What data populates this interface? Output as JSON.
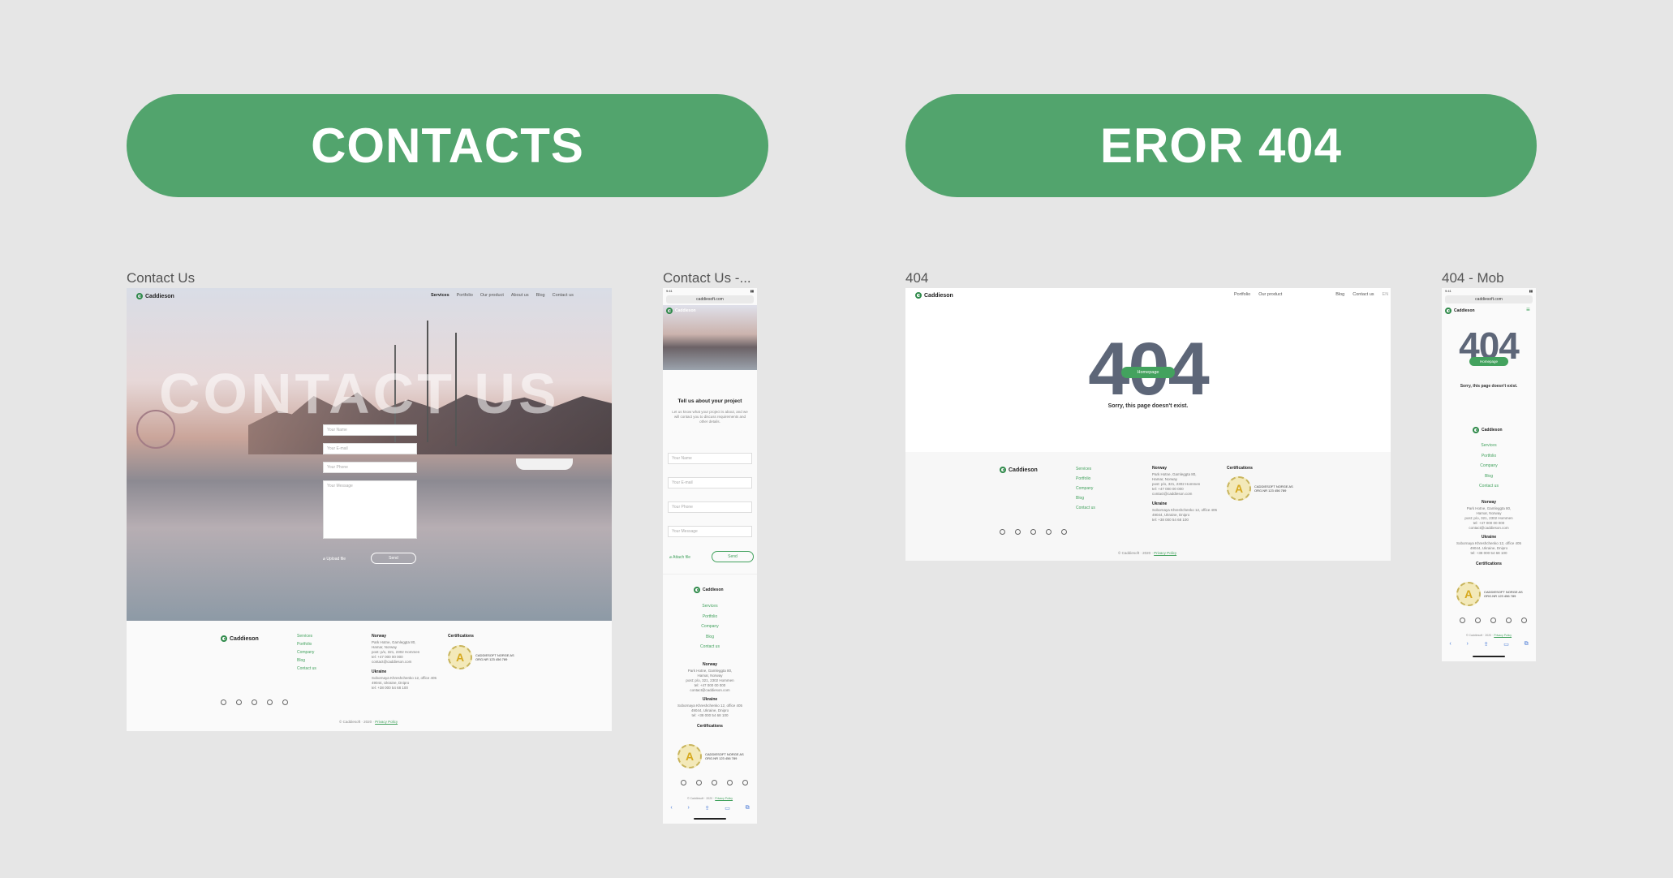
{
  "sections": {
    "contacts": "CONTACTS",
    "error": "EROR 404"
  },
  "boards": {
    "contact_desktop": "Contact Us",
    "contact_mobile": "Contact Us -...",
    "error_desktop": "404",
    "error_mobile": "404 - Mob"
  },
  "brand": {
    "name": "Caddieson",
    "accent": "#52a46d",
    "link_green": "#43a25e"
  },
  "nav": {
    "items": [
      "Services",
      "Portfolio",
      "Our product",
      "About us",
      "Blog",
      "Contact us"
    ],
    "error_items": [
      "Portfolio",
      "Our product",
      "Blog",
      "Contact us"
    ],
    "lang": "EN"
  },
  "contact_page": {
    "hero_title": "CONTACT US",
    "placeholders": {
      "name": "Your Name",
      "email": "Your E-mail",
      "phone": "Your Phone",
      "message": "Your Message"
    },
    "attach": "Upload file",
    "attach_mobile": "Attach file",
    "send": "Send",
    "mobile_heading": "Tell us about your project",
    "mobile_intro": "Let us know what your project is about, and we will contact you to discuss requirements and other details."
  },
  "footer": {
    "links": [
      "Services",
      "Portfolio",
      "Company",
      "Blog",
      "Contact us"
    ],
    "norway_title": "Norway",
    "norway_lines": [
      "Park Hotne, Gamleggta 80,",
      "Hamar, Norway",
      "post: p/o, 321, 2302 Hommen",
      "tel: +47 000 00 000",
      "contact@caddieson.com"
    ],
    "ukraine_title": "Ukraine",
    "ukraine_lines": [
      "Sobornaya Khreshchenko 12, office 405",
      "49044, Ukraine, Dnipro",
      "tel: +38 000 54 68 100"
    ],
    "cert_title": "Certifications",
    "cert_line1": "CADDIESOFT NORGE AS",
    "cert_line2": "ORG.NR 123 456 789",
    "copyright": "© Caddiesoft · 2020 ·",
    "privacy": "Privacy Policy"
  },
  "error_page": {
    "code": "404",
    "button": "Homepage",
    "message": "Sorry, this page doesn't exist."
  },
  "mobile": {
    "time": "9:41",
    "url": "caddiesoft.com",
    "bottom_icons": [
      "‹",
      "›",
      "⇪",
      "▭",
      "⧉"
    ]
  }
}
